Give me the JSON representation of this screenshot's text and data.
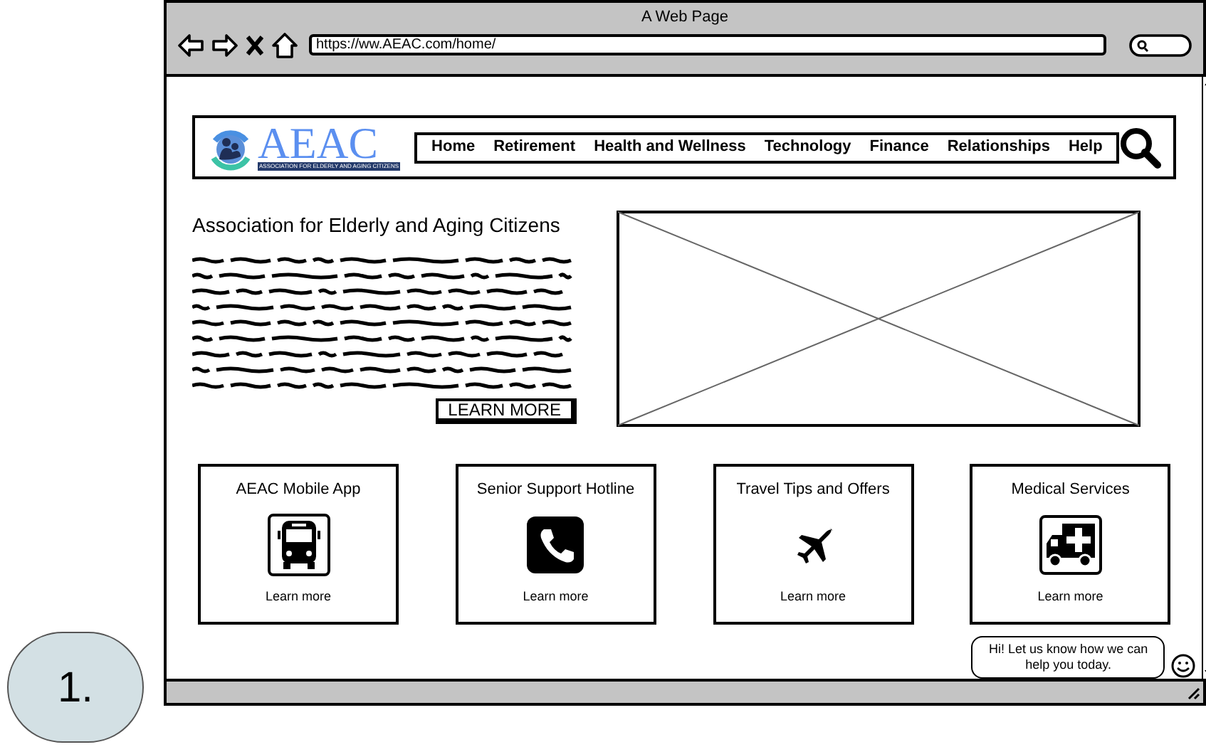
{
  "annotation": {
    "label": "1."
  },
  "window": {
    "title": "A Web Page",
    "url": "https://ww.AEAC.com/home/"
  },
  "logo": {
    "name": "AEAC",
    "tagline": "ASSOCIATION FOR ELDERLY AND AGING CITIZENS"
  },
  "nav": [
    {
      "label": "Home"
    },
    {
      "label": "Retirement"
    },
    {
      "label": "Health and Wellness"
    },
    {
      "label": "Technology"
    },
    {
      "label": "Finance"
    },
    {
      "label": "Relationships"
    },
    {
      "label": "Help"
    }
  ],
  "hero": {
    "heading": "Association for Elderly and Aging Citizens",
    "button": "LEARN MORE"
  },
  "cards": [
    {
      "title": "AEAC Mobile App",
      "kind": "bus",
      "link": "Learn more"
    },
    {
      "title": "Senior Support Hotline",
      "kind": "phone",
      "link": "Learn more"
    },
    {
      "title": "Travel Tips and Offers",
      "kind": "plane",
      "link": "Learn more"
    },
    {
      "title": "Medical Services",
      "kind": "ambulance",
      "link": "Learn more"
    }
  ],
  "chat": {
    "message": "Hi! Let us know how we can help you today."
  }
}
